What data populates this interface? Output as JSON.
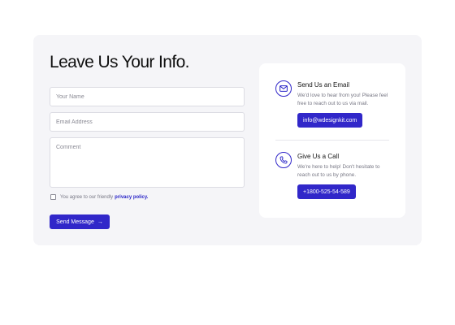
{
  "form": {
    "title": "Leave Us Your Info.",
    "name_placeholder": "Your Name",
    "email_placeholder": "Email Address",
    "comment_placeholder": "Comment",
    "agree_text": "You agree to our friendly",
    "agree_link": "privacy policy.",
    "send_label": "Send Message",
    "send_icon": "arrow-right-icon"
  },
  "contact": {
    "email": {
      "heading": "Send Us an Email",
      "text": "We'd love to hear from you! Please feel free to reach out to us via mail.",
      "button": "info@wdesignkit.com",
      "icon": "mail-icon"
    },
    "call": {
      "heading": "Give Us a Call",
      "text": "We're here to help! Don't hesitate to reach out to us by phone.",
      "button": "+1800-525-54-589",
      "icon": "phone-icon"
    }
  },
  "colors": {
    "accent": "#3127c9",
    "card_background": "#f5f5f8"
  }
}
